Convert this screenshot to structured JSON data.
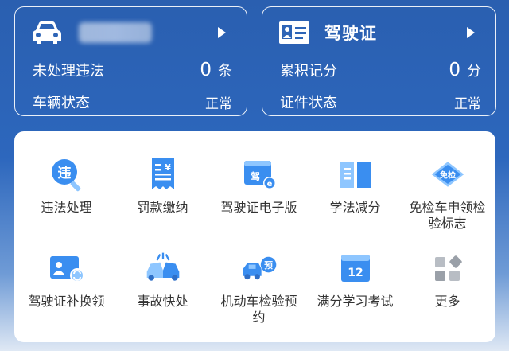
{
  "vehicle_card": {
    "unprocessed_label": "未处理违法",
    "unprocessed_count": "0",
    "unprocessed_unit": "条",
    "status_label": "车辆状态",
    "status_value": "正常"
  },
  "license_card": {
    "title": "驾驶证",
    "points_label": "累积记分",
    "points_value": "0",
    "points_unit": "分",
    "status_label": "证件状态",
    "status_value": "正常"
  },
  "services": [
    {
      "label": "违法处理",
      "icon": "search-violation-icon"
    },
    {
      "label": "罚款缴纳",
      "icon": "receipt-icon"
    },
    {
      "label": "驾驶证电子版",
      "icon": "e-license-icon"
    },
    {
      "label": "学法减分",
      "icon": "book-icon"
    },
    {
      "label": "免检车申领检验标志",
      "icon": "exempt-tag-icon"
    },
    {
      "label": "驾驶证补换领",
      "icon": "license-renew-icon"
    },
    {
      "label": "事故快处",
      "icon": "accident-icon"
    },
    {
      "label": "机动车检验预约",
      "icon": "inspection-booking-icon"
    },
    {
      "label": "满分学习考试",
      "icon": "calendar-12-icon"
    },
    {
      "label": "更多",
      "icon": "more-grid-icon"
    }
  ],
  "service_icon_text": {
    "violation": "违",
    "receipt": "¥",
    "license": "驾",
    "e": "e",
    "exempt": "免检",
    "booking": "预",
    "calendar": "12"
  },
  "colors": {
    "brand_blue": "#2a5fb0",
    "icon_blue": "#2f7fe0",
    "icon_light": "#8ec6ff",
    "icon_gray": "#9aa0a8"
  }
}
